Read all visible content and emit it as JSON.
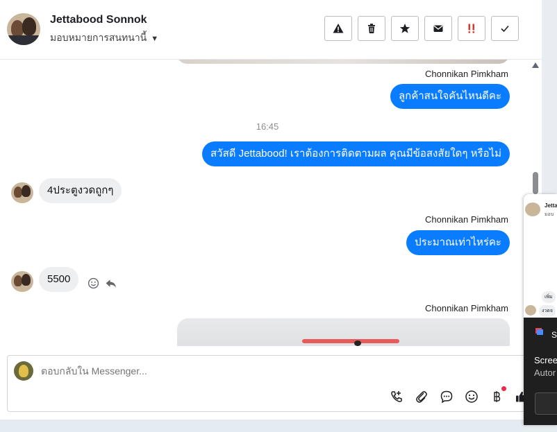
{
  "header": {
    "contact_name": "Jettabood Sonnok",
    "assign_label": "มอบหมายการสนทนานี้",
    "actions": [
      "warning-icon",
      "trash-icon",
      "star-icon",
      "envelope-icon",
      "spam-icon",
      "check-icon"
    ]
  },
  "messages": {
    "sender1": "Chonnikan Pimkham",
    "out1": "ลูกค้าสนใจคันไหนดีคะ",
    "time1": "16:45",
    "out2": "สวัสดี Jettabood! เราต้องการติดตามผล คุณมีข้อสงสัยใดๆ หรือไม่",
    "in1": "4ประตูงวดถูกๆ",
    "sender2": "Chonnikan Pimkham",
    "out3": "ประมาณเท่าไหร่คะ",
    "in2": "5500",
    "sender3": "Chonnikan Pimkham"
  },
  "composer": {
    "placeholder": "ตอบกลับใน Messenger...",
    "tools": [
      "phone-add-icon",
      "paperclip-icon",
      "speech-bubble-icon",
      "emoji-icon",
      "baht-icon",
      "thumbs-up-icon"
    ]
  },
  "overlay": {
    "mini_name": "Jetta",
    "mini_sub": "มอบ",
    "mini_msg1": "เพิ่ม",
    "mini_msg2": "งวดจ",
    "panel_title": "Sh",
    "line1": "Scree",
    "line2": "Autor"
  },
  "colors": {
    "accent": "#0a7cff",
    "spam": "#d93025"
  }
}
